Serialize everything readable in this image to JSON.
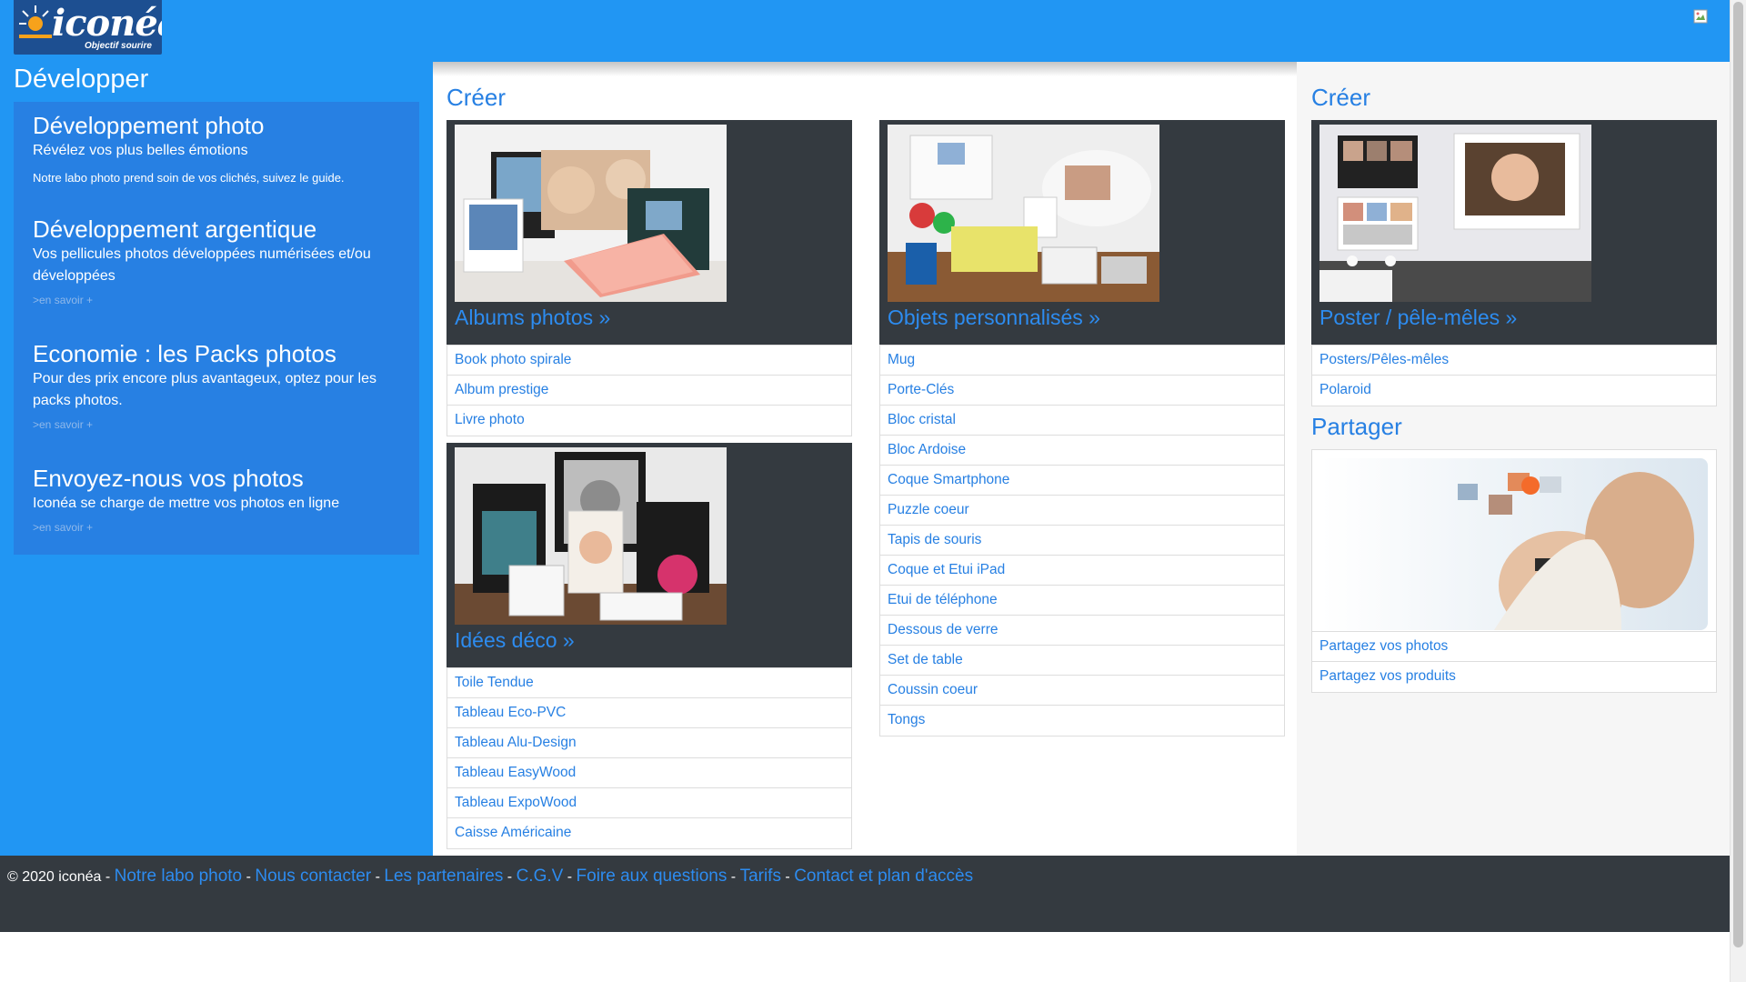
{
  "header": {
    "logo_brand": "iconéa",
    "logo_tagline": "Objectif sourire"
  },
  "left": {
    "title": "Développer",
    "items": [
      {
        "title": "Développement photo",
        "desc": "Révélez vos plus belles émotions",
        "note": "Notre labo photo prend soin de vos clichés, suivez le guide.",
        "more": ""
      },
      {
        "title": "Développement argentique",
        "desc": "Vos pellicules photos développées numérisées et/ou développées",
        "note": "",
        "more": ">en savoir +"
      },
      {
        "title": "Economie : les Packs photos",
        "desc": "Pour des prix encore plus avantageux, optez pour les packs photos.",
        "note": "",
        "more": ">en savoir +"
      },
      {
        "title": "Envoyez-nous vos photos",
        "desc": "Iconéa se charge de mettre vos photos en ligne",
        "note": "",
        "more": ">en savoir +"
      }
    ]
  },
  "middle": {
    "title": "Créer",
    "albums": {
      "caption": "Albums photos »",
      "items": [
        "Book photo spirale",
        "Album prestige",
        "Livre photo"
      ]
    },
    "deco": {
      "caption": "Idées déco »",
      "items": [
        "Toile Tendue",
        "Tableau Eco-PVC",
        "Tableau Alu-Design",
        "Tableau EasyWood",
        "Tableau ExpoWood",
        "Caisse Américaine"
      ]
    },
    "objets": {
      "caption": "Objets personnalisés »",
      "items": [
        "Mug",
        "Porte-Clés",
        "Bloc cristal",
        "Bloc Ardoise",
        "Coque Smartphone",
        "Puzzle coeur",
        "Tapis de souris",
        "Coque et Etui iPad",
        "Etui de téléphone",
        "Dessous de verre",
        "Set de table",
        "Coussin coeur",
        "Tongs"
      ]
    }
  },
  "right": {
    "title": "Créer",
    "poster": {
      "caption": "Poster / pêle-mêles »",
      "items": [
        "Posters/Pêles-mêles",
        "Polaroid"
      ]
    },
    "share_title": "Partager",
    "share_items": [
      "Partagez vos photos",
      "Partagez vos produits"
    ]
  },
  "footer": {
    "copyright": "© 2020 iconéa - ",
    "links": [
      "Notre labo photo",
      "Nous contacter",
      "Les partenaires",
      "C.G.V",
      "Foire aux questions",
      "Tarifs",
      "Contact et plan d'accès"
    ]
  },
  "colors": {
    "header_blue": "#2196f3",
    "panel_blue": "#2780e3",
    "dark": "#343a40",
    "link": "#2780e3"
  }
}
